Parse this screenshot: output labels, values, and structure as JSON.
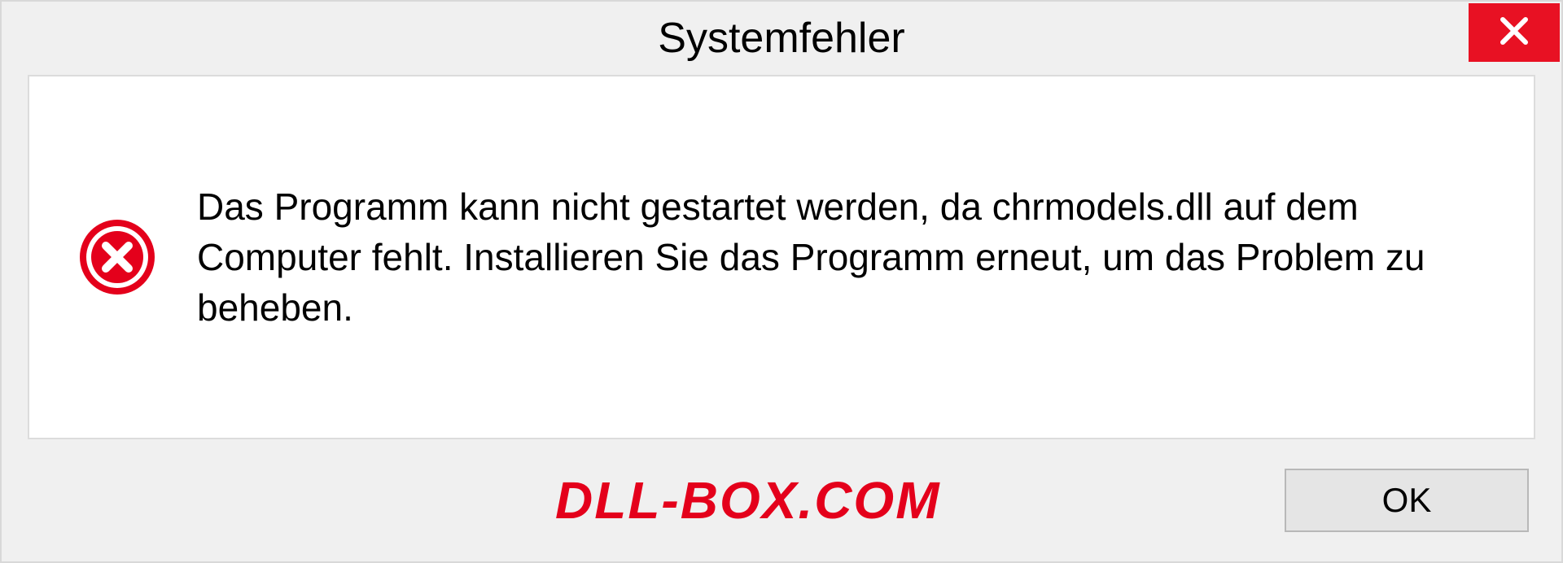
{
  "dialog": {
    "title": "Systemfehler",
    "message": "Das Programm kann nicht gestartet werden, da chrmodels.dll auf dem Computer fehlt. Installieren Sie das Programm erneut, um das Problem zu beheben.",
    "ok_label": "OK",
    "watermark": "DLL-BOX.COM"
  }
}
